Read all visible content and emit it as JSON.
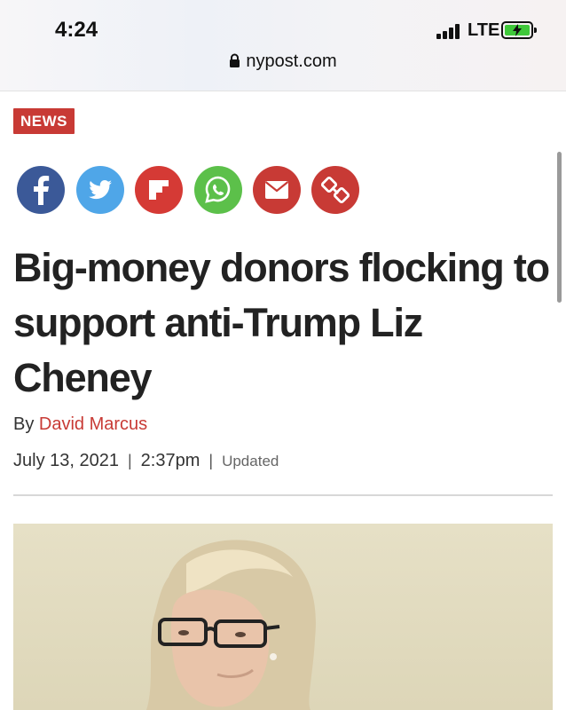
{
  "status_bar": {
    "time": "4:24",
    "network": "LTE",
    "battery_charging": true,
    "battery_color": "#3fc83a"
  },
  "url_bar": {
    "domain": "nypost.com",
    "icon": "lock-icon"
  },
  "article": {
    "section_badge": "NEWS",
    "share_buttons": [
      {
        "name": "facebook",
        "icon": "facebook-icon",
        "color": "#3b5998"
      },
      {
        "name": "twitter",
        "icon": "twitter-icon",
        "color": "#4fa6e8"
      },
      {
        "name": "flipboard",
        "icon": "flipboard-icon",
        "color": "#d53a35"
      },
      {
        "name": "whatsapp",
        "icon": "whatsapp-icon",
        "color": "#5cc04a"
      },
      {
        "name": "email",
        "icon": "email-icon",
        "color": "#c83a35"
      },
      {
        "name": "copy-link",
        "icon": "link-icon",
        "color": "#c83a35"
      }
    ],
    "headline": "Big-money donors flocking to support anti-Trump Liz Cheney",
    "byline_prefix": "By",
    "author": "David Marcus",
    "date": "July 13, 2021",
    "time": "2:37pm",
    "separator": "|",
    "updated_label": "Updated"
  },
  "colors": {
    "brand_red": "#c83a35",
    "headline_text": "#222222"
  }
}
